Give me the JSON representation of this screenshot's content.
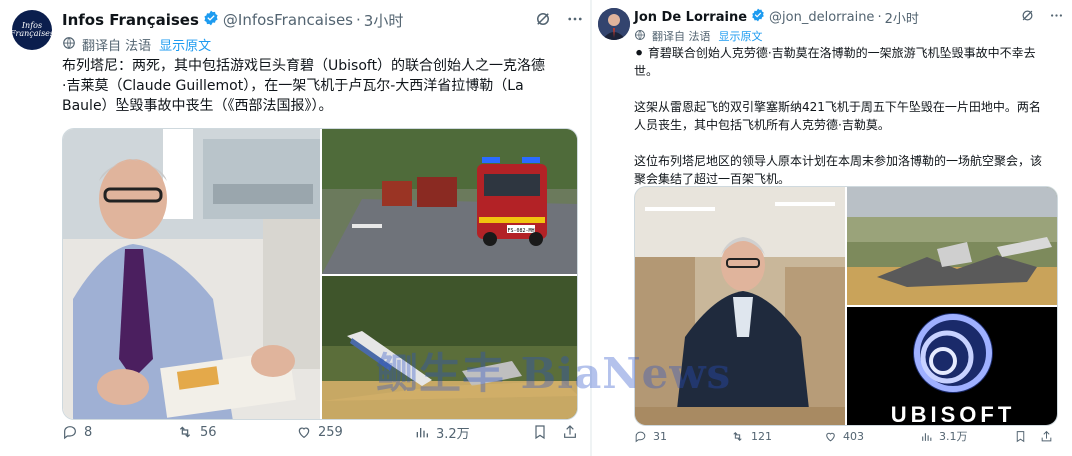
{
  "colors": {
    "accent": "#1d9bf0",
    "muted": "#536471",
    "verified": "#1d9bf0"
  },
  "left": {
    "author": {
      "name": "Infos Françaises",
      "handle": "@InfosFrancaises",
      "time": "3小时",
      "avatar_text_1": "Infos",
      "avatar_text_2": "Françaises"
    },
    "translate": {
      "label": "翻译自 法语",
      "show_original": "显示原文"
    },
    "text": "布列塔尼：两死，其中包括游戏巨头育碧（Ubisoft）的联合创始人之一克洛德\n·吉莱莫（Claude Guillemot），在一架飞机于卢瓦尔-大西洋省拉博勒（La\nBaule）坠毁事故中丧生（《西部法国报》）。",
    "media_plate": "FS-082-MH",
    "stats": {
      "replies": "8",
      "retweets": "56",
      "likes": "259",
      "views": "3.2万"
    }
  },
  "right": {
    "author": {
      "name": "Jon De Lorraine",
      "handle": "@jon_delorraine",
      "time": "2小时"
    },
    "translate": {
      "label": "翻译自 法语",
      "show_original": "显示原文"
    },
    "text": "⚫ 育碧联合创始人克劳德·吉勒莫在洛博勒的一架旅游飞机坠毁事故中不幸去\n世。\n\n这架从雷恩起飞的双引擎塞斯纳421飞机于周五下午坠毁在一片田地中。两名\n人员丧生，其中包括飞机所有人克劳德·吉勒莫。\n\n这位布列塔尼地区的领导人原本计划在本周末参加洛博勒的一场航空聚会，该\n聚会集结了超过一百架飞机。",
    "ubisoft_logo": "UBISOFT",
    "stats": {
      "replies": "31",
      "retweets": "121",
      "likes": "403",
      "views": "3.1万"
    }
  },
  "watermark": "鲗生丰 BiaNews",
  "icons": [
    "verified-badge-icon",
    "grok-icon",
    "more-icon",
    "translate-icon",
    "reply-icon",
    "retweet-icon",
    "like-icon",
    "views-icon",
    "bookmark-icon",
    "share-icon"
  ]
}
